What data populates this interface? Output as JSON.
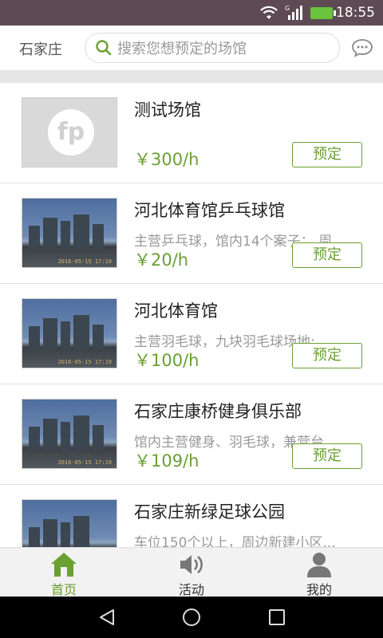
{
  "status_bar": {
    "time": "18:55",
    "signal_label": "G"
  },
  "header": {
    "city": "石家庄",
    "search_placeholder": "搜索您想预定的场馆"
  },
  "venues": [
    {
      "name": "测试场馆",
      "desc": "",
      "price": "￥300/h",
      "button": "预定",
      "thumb": "logo-placeholder"
    },
    {
      "name": "河北体育馆乒乓球馆",
      "desc": "主营乒乓球，馆内14个案子； 周...",
      "price": "￥20/h",
      "button": "预定",
      "thumb": "photo"
    },
    {
      "name": "河北体育馆",
      "desc": "主营羽毛球，九块羽毛球场地: ...",
      "price": "￥100/h",
      "button": "预定",
      "thumb": "photo"
    },
    {
      "name": "石家庄康桥健身俱乐部",
      "desc": "馆内主营健身、羽毛球，兼营台...",
      "price": "￥109/h",
      "button": "预定",
      "thumb": "photo"
    },
    {
      "name": "石家庄新绿足球公园",
      "desc": "车位150个以上，周边新建小区...",
      "price": "",
      "button": "",
      "thumb": "photo"
    }
  ],
  "photo_stamp": "2016-05-15 17:19",
  "tabs": [
    {
      "label": "首页",
      "icon": "home-icon",
      "active": true
    },
    {
      "label": "活动",
      "icon": "speaker-icon",
      "active": false
    },
    {
      "label": "我的",
      "icon": "user-icon",
      "active": false
    }
  ],
  "colors": {
    "accent": "#6aa032",
    "status_bar": "#5e4a52",
    "tabbar": "#f2f2f2"
  }
}
